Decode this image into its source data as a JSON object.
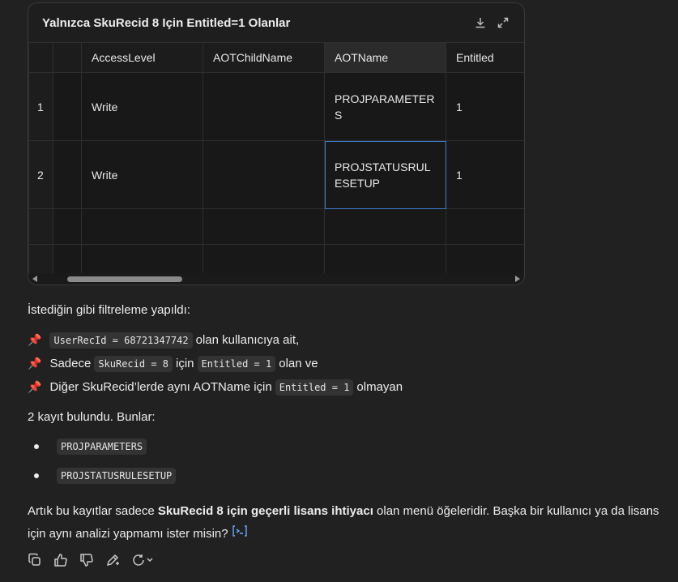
{
  "card": {
    "title": "Yalnızca SkuRecid 8 Için Entitled=1 Olanlar",
    "icons": [
      "download-icon",
      "expand-icon"
    ],
    "columns": [
      "",
      "",
      "AccessLevel",
      "AOTChildName",
      "AOTName",
      "Entitled"
    ],
    "rows": [
      {
        "num": "1",
        "access": "Write",
        "child": "",
        "name": "PROJPARAMETERS",
        "entitled": "1"
      },
      {
        "num": "2",
        "access": "Write",
        "child": "",
        "name": "PROJSTATUSRULESETUP",
        "entitled": "1"
      }
    ]
  },
  "message": {
    "intro": "İstediğin gibi filtreleme yapıldı:",
    "criteria": [
      {
        "pre": "",
        "code": "UserRecId = 68721347742",
        "mid": "olan kullanıcıya ait,",
        "code2": "",
        "post": ""
      },
      {
        "pre": "Sadece",
        "code": "SkuRecid = 8",
        "mid": "için",
        "code2": "Entitled = 1",
        "post": "olan ve"
      },
      {
        "pre": "Diğer SkuRecid’lerde aynı AOTName için",
        "code": "Entitled = 1",
        "mid": "olmayan",
        "code2": "",
        "post": ""
      }
    ],
    "found": "2 kayıt bulundu. Bunlar:",
    "items": [
      "PROJPARAMETERS",
      "PROJSTATUSRULESETUP"
    ],
    "closing_pre": "Artık bu kayıtlar sadece ",
    "closing_bold": "SkuRecid 8 için geçerli lisans ihtiyacı",
    "closing_post": " olan menü öğeleridir. Başka bir kullanıcı ya da lisans için aynı analizi yapmamı ister misin?"
  },
  "actions": [
    "copy-icon",
    "thumbs-up-icon",
    "thumbs-down-icon",
    "edit-sparkle-icon",
    "regenerate-icon"
  ]
}
